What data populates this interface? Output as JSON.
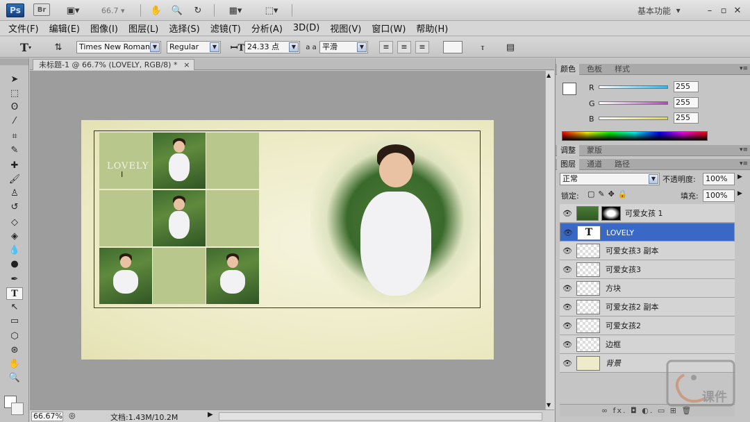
{
  "titlebar": {
    "ps_label": "Ps",
    "br_label": "Br",
    "zoom": "66.7",
    "workspace": "基本功能"
  },
  "menu": [
    "文件(F)",
    "编辑(E)",
    "图像(I)",
    "图层(L)",
    "选择(S)",
    "滤镜(T)",
    "分析(A)",
    "3D(D)",
    "视图(V)",
    "窗口(W)",
    "帮助(H)"
  ],
  "options": {
    "tool_glyph": "T",
    "font_family": "Times New Roman",
    "font_style": "Regular",
    "font_size": "24.33 点",
    "aa_label": "a a",
    "antialias": "平滑"
  },
  "document": {
    "tab_title": "未标题-1 @ 66.7% (LOVELY, RGB/8) *",
    "close": "×",
    "lovely_text": "LOVELY",
    "ibeam": "Ⅰ"
  },
  "status": {
    "zoom": "66.67%",
    "doc_info": "文档:1.43M/10.2M"
  },
  "color_panel": {
    "tabs": [
      "颜色",
      "色板",
      "样式"
    ],
    "channels": [
      {
        "label": "R",
        "value": "255",
        "color": "#2fb3e6"
      },
      {
        "label": "G",
        "value": "255",
        "color": "#c23ad0"
      },
      {
        "label": "B",
        "value": "255",
        "color": "#e2d838"
      }
    ]
  },
  "adjust_panel": {
    "tabs": [
      "调整",
      "蒙版"
    ]
  },
  "layers_panel": {
    "tabs": [
      "图层",
      "通道",
      "路径"
    ],
    "blend_mode": "正常",
    "opacity_label": "不透明度:",
    "opacity": "100%",
    "lock_label": "锁定:",
    "fill_label": "填充:",
    "fill": "100%",
    "layers": [
      {
        "name": "可爱女孩 1",
        "selected": false
      },
      {
        "name": "LOVELY",
        "selected": true
      },
      {
        "name": "可爱女孩3 副本",
        "selected": false
      },
      {
        "name": "可爱女孩3",
        "selected": false
      },
      {
        "name": "方块",
        "selected": false
      },
      {
        "name": "可爱女孩2 副本",
        "selected": false
      },
      {
        "name": "可爱女孩2",
        "selected": false
      },
      {
        "name": "边框",
        "selected": false
      },
      {
        "name": "背景",
        "selected": false
      }
    ],
    "bottom_icons": "∞  fx.  ◘  ◐.  ▭  ⊞  🗑"
  },
  "watermark": {
    "text": "课件"
  }
}
